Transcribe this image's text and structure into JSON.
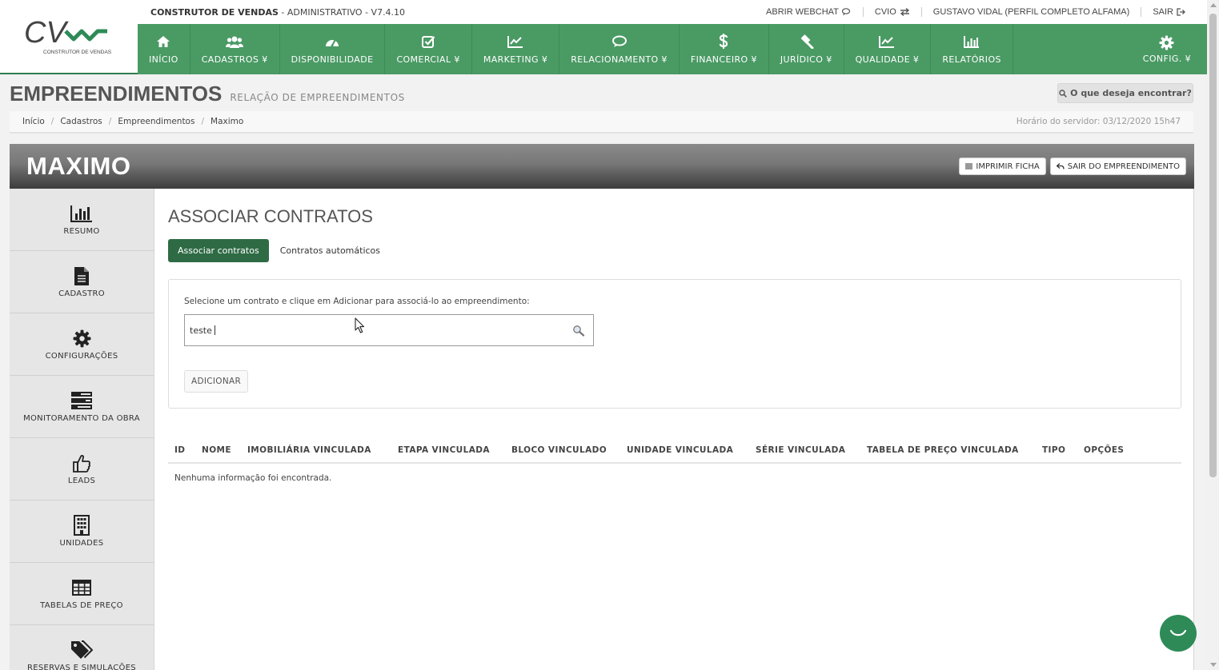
{
  "header": {
    "brand_name": "CONSTRUTOR DE VENDAS",
    "brand_suffix": " - ADMINISTRATIVO - V7.4.10",
    "logo_text": "CV",
    "logo_sub": "CONSTRUTOR DE VENDAS",
    "links": {
      "webchat": "ABRIR WEBCHAT",
      "cvio": "CVIO",
      "user": "GUSTAVO VIDAL (PERFIL COMPLETO ALFAMA)",
      "logout": "SAIR"
    }
  },
  "nav": {
    "items": [
      {
        "label": "INÍCIO",
        "icon": "home-icon"
      },
      {
        "label": "CADASTROS ¥",
        "icon": "users-icon"
      },
      {
        "label": "DISPONIBILIDADE",
        "icon": "dashboard-icon"
      },
      {
        "label": "COMERCIAL ¥",
        "icon": "check-square-icon"
      },
      {
        "label": "MARKETING ¥",
        "icon": "line-chart-icon"
      },
      {
        "label": "RELACIONAMENTO ¥",
        "icon": "comments-icon"
      },
      {
        "label": "FINANCEIRO ¥",
        "icon": "dollar-icon"
      },
      {
        "label": "JURÍDICO ¥",
        "icon": "gavel-icon"
      },
      {
        "label": "QUALIDADE ¥",
        "icon": "line-chart-icon"
      },
      {
        "label": "RELATÓRIOS",
        "icon": "bar-chart-icon"
      }
    ],
    "config": {
      "label": "CONFIG. ¥",
      "icon": "gear-icon"
    }
  },
  "page": {
    "title": "EMPREENDIMENTOS",
    "subtitle": "RELAÇÃO DE EMPREENDIMENTOS",
    "search_label": "O que deseja encontrar?",
    "breadcrumb": [
      "Início",
      "Cadastros",
      "Empreendimentos",
      "Maximo"
    ],
    "server_time": "Horário do servidor: 03/12/2020 15h47"
  },
  "project": {
    "name": "MAXIMO",
    "print_label": "IMPRIMIR FICHA",
    "exit_label": "SAIR DO EMPREENDIMENTO"
  },
  "sidebar": {
    "items": [
      {
        "label": "RESUMO",
        "icon": "bar-chart-icon"
      },
      {
        "label": "CADASTRO",
        "icon": "file-icon"
      },
      {
        "label": "CONFIGURAÇÕES",
        "icon": "gear-icon"
      },
      {
        "label": "MONITORAMENTO DA OBRA",
        "icon": "tasks-icon"
      },
      {
        "label": "LEADS",
        "icon": "thumbs-up-icon"
      },
      {
        "label": "UNIDADES",
        "icon": "building-icon"
      },
      {
        "label": "TABELAS DE PREÇO",
        "icon": "table-icon"
      },
      {
        "label": "RESERVAS E SIMULAÇÕES",
        "icon": "tags-icon"
      }
    ]
  },
  "main": {
    "heading": "ASSOCIAR CONTRATOS",
    "tabs": [
      {
        "label": "Associar contratos",
        "active": true
      },
      {
        "label": "Contratos automáticos",
        "active": false
      }
    ],
    "hint": "Selecione um contrato e clique em Adicionar para associá-lo ao empreendimento:",
    "search_value": "teste",
    "add_label": "ADICIONAR",
    "table": {
      "columns": [
        "ID",
        "NOME",
        "IMOBILIÁRIA VINCULADA",
        "ETAPA VINCULADA",
        "BLOCO VINCULADO",
        "UNIDADE VINCULADA",
        "SÉRIE VINCULADA",
        "TABELA DE PREÇO VINCULADA",
        "TIPO",
        "OPÇÕES"
      ],
      "empty_message": "Nenhuma informação foi encontrada."
    }
  },
  "colors": {
    "nav_green": "#4a9a64",
    "active_tab": "#2e6b45",
    "chat": "#2e8b57"
  }
}
